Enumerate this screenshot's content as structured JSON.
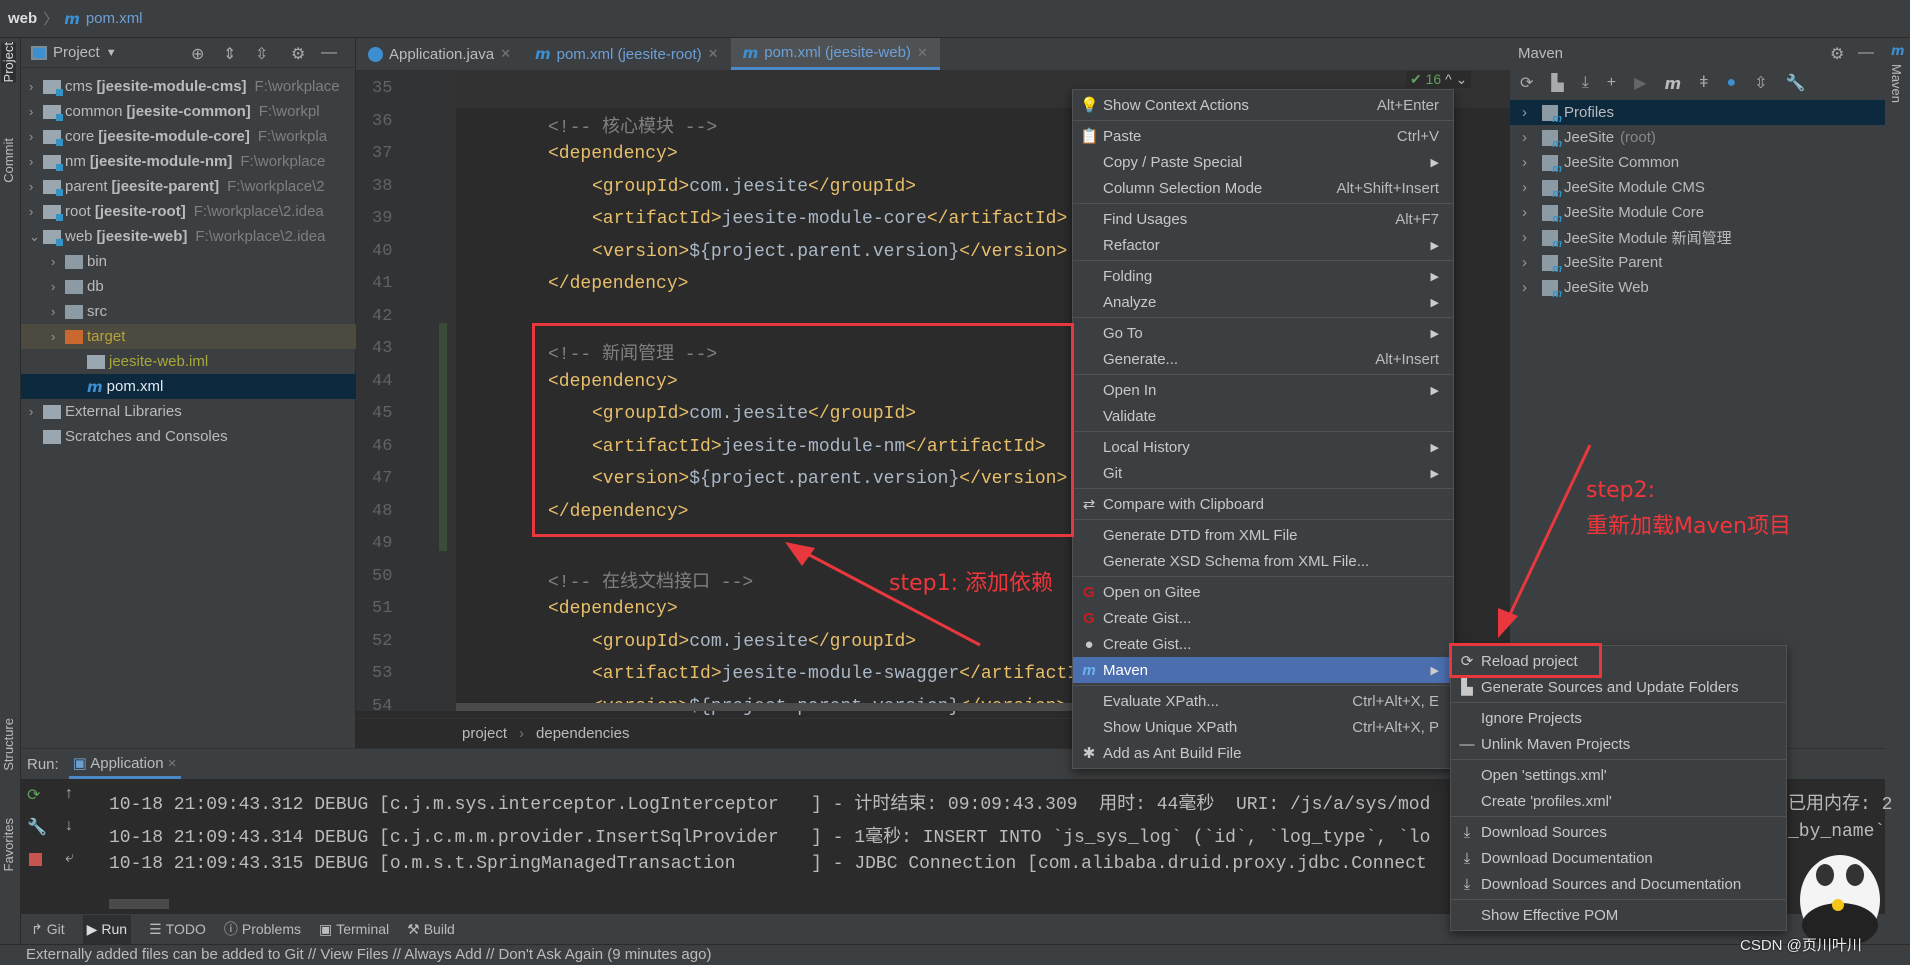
{
  "topbar": {
    "crumb": "web",
    "file": "pom.xml"
  },
  "left_strip": {
    "project": "Project",
    "commit": "Commit",
    "structure": "Structure",
    "favorites": "Favorites"
  },
  "right_strip": {
    "maven": "Maven"
  },
  "project": {
    "title": "Project",
    "tree": [
      {
        "level": 0,
        "chev": "›",
        "icon": "module",
        "name": "cms",
        "bold": "[jeesite-module-cms]",
        "path": "F:\\workplace"
      },
      {
        "level": 0,
        "chev": "›",
        "icon": "module",
        "name": "common",
        "bold": "[jeesite-common]",
        "path": "F:\\workpl"
      },
      {
        "level": 0,
        "chev": "›",
        "icon": "module",
        "name": "core",
        "bold": "[jeesite-module-core]",
        "path": "F:\\workpla"
      },
      {
        "level": 0,
        "chev": "›",
        "icon": "module",
        "name": "nm",
        "bold": "[jeesite-module-nm]",
        "path": "F:\\workplace"
      },
      {
        "level": 0,
        "chev": "›",
        "icon": "module",
        "name": "parent",
        "bold": "[jeesite-parent]",
        "path": "F:\\workplace\\2"
      },
      {
        "level": 0,
        "chev": "›",
        "icon": "module",
        "name": "root",
        "bold": "[jeesite-root]",
        "path": "F:\\workplace\\2.idea"
      },
      {
        "level": 0,
        "chev": "⌄",
        "icon": "module",
        "name": "web",
        "bold": "[jeesite-web]",
        "path": "F:\\workplace\\2.idea"
      },
      {
        "level": 1,
        "chev": "›",
        "icon": "folder",
        "name": "bin"
      },
      {
        "level": 1,
        "chev": "›",
        "icon": "folder",
        "name": "db"
      },
      {
        "level": 1,
        "chev": "›",
        "icon": "folder",
        "name": "src"
      },
      {
        "level": 1,
        "chev": "›",
        "icon": "folder-excluded",
        "name": "target",
        "state": "excluded"
      },
      {
        "level": 2,
        "chev": "",
        "icon": "iml-file",
        "name": "jeesite-web.iml",
        "state": "untracked"
      },
      {
        "level": 2,
        "chev": "",
        "icon": "maven-file",
        "name": "pom.xml",
        "state": "selected"
      },
      {
        "level": 0,
        "chev": "›",
        "icon": "libraries",
        "name": "External Libraries"
      },
      {
        "level": 0,
        "chev": "",
        "icon": "scratches",
        "name": "Scratches and Consoles"
      }
    ]
  },
  "editor": {
    "tabs": [
      {
        "label": "Application.java",
        "icon": "java-class-icon",
        "active": false
      },
      {
        "label": "pom.xml (jeesite-root)",
        "icon": "maven-icon",
        "active": false
      },
      {
        "label": "pom.xml (jeesite-web)",
        "icon": "maven-icon",
        "active": true
      }
    ],
    "inspections": "✔ 16",
    "lines": [
      {
        "n": "35",
        "indent": 0,
        "text": ""
      },
      {
        "n": "36",
        "indent": 1,
        "text": "<!-- 核心模块 -->"
      },
      {
        "n": "37",
        "indent": 1,
        "text": "<dependency>"
      },
      {
        "n": "38",
        "indent": 2,
        "text": "<groupId>com.jeesite</groupId>"
      },
      {
        "n": "39",
        "indent": 2,
        "text": "<artifactId>jeesite-module-core</artifactId>"
      },
      {
        "n": "40",
        "indent": 2,
        "text": "<version>${project.parent.version}</version>"
      },
      {
        "n": "41",
        "indent": 1,
        "text": "</dependency>"
      },
      {
        "n": "42",
        "indent": 0,
        "text": ""
      },
      {
        "n": "43",
        "indent": 1,
        "text": "<!-- 新闻管理 -->"
      },
      {
        "n": "44",
        "indent": 1,
        "text": "<dependency>"
      },
      {
        "n": "45",
        "indent": 2,
        "text": "<groupId>com.jeesite</groupId>"
      },
      {
        "n": "46",
        "indent": 2,
        "text": "<artifactId>jeesite-module-nm</artifactId>"
      },
      {
        "n": "47",
        "indent": 2,
        "text": "<version>${project.parent.version}</version>"
      },
      {
        "n": "48",
        "indent": 1,
        "text": "</dependency>"
      },
      {
        "n": "49",
        "indent": 0,
        "text": ""
      },
      {
        "n": "50",
        "indent": 1,
        "text": "<!-- 在线文档接口 -->"
      },
      {
        "n": "51",
        "indent": 1,
        "text": "<dependency>"
      },
      {
        "n": "52",
        "indent": 2,
        "text": "<groupId>com.jeesite</groupId>"
      },
      {
        "n": "53",
        "indent": 2,
        "text": "<artifactId>jeesite-module-swagger</artifactId>"
      },
      {
        "n": "54",
        "indent": 2,
        "text": "<version>${project.parent.version}</version>"
      }
    ],
    "breadcrumbs": [
      "project",
      "dependencies"
    ]
  },
  "annotations": {
    "step1": "step1: 添加依赖",
    "step2_line1": "step2:",
    "step2_line2": "重新加载Maven项目"
  },
  "context_menu": [
    [
      {
        "label": "Show Context Actions",
        "shortcut": "Alt+Enter",
        "icon": "bulb-icon"
      }
    ],
    [
      {
        "label": "Paste",
        "shortcut": "Ctrl+V",
        "icon": "clipboard-icon"
      },
      {
        "label": "Copy / Paste Special",
        "submenu": true
      },
      {
        "label": "Column Selection Mode",
        "shortcut": "Alt+Shift+Insert"
      }
    ],
    [
      {
        "label": "Find Usages",
        "shortcut": "Alt+F7"
      },
      {
        "label": "Refactor",
        "submenu": true
      }
    ],
    [
      {
        "label": "Folding",
        "submenu": true
      },
      {
        "label": "Analyze",
        "submenu": true
      }
    ],
    [
      {
        "label": "Go To",
        "submenu": true
      },
      {
        "label": "Generate...",
        "shortcut": "Alt+Insert"
      }
    ],
    [
      {
        "label": "Open In",
        "submenu": true
      },
      {
        "label": "Validate"
      }
    ],
    [
      {
        "label": "Local History",
        "submenu": true
      },
      {
        "label": "Git",
        "submenu": true
      }
    ],
    [
      {
        "label": "Compare with Clipboard",
        "icon": "compare-icon"
      }
    ],
    [
      {
        "label": "Generate DTD from XML File"
      },
      {
        "label": "Generate XSD Schema from XML File..."
      }
    ],
    [
      {
        "label": "Open on Gitee",
        "icon": "gitee-icon"
      },
      {
        "label": "Create Gist...",
        "icon": "gitee-icon"
      },
      {
        "label": "Create Gist...",
        "icon": "github-icon"
      },
      {
        "label": "Maven",
        "submenu": true,
        "icon": "maven-icon",
        "highlighted": true
      }
    ],
    [
      {
        "label": "Evaluate XPath...",
        "shortcut": "Ctrl+Alt+X, E"
      },
      {
        "label": "Show Unique XPath",
        "shortcut": "Ctrl+Alt+X, P"
      },
      {
        "label": "Add as Ant Build File",
        "icon": "ant-icon"
      }
    ]
  ],
  "maven_submenu": [
    [
      {
        "label": "Reload project",
        "icon": "reload-icon"
      },
      {
        "label": "Generate Sources and Update Folders",
        "icon": "generate-sources-icon"
      }
    ],
    [
      {
        "label": "Ignore Projects"
      },
      {
        "label": "Unlink Maven Projects",
        "icon": "minus-icon"
      }
    ],
    [
      {
        "label": "Open 'settings.xml'"
      },
      {
        "label": "Create 'profiles.xml'"
      }
    ],
    [
      {
        "label": "Download Sources",
        "icon": "download-icon"
      },
      {
        "label": "Download Documentation",
        "icon": "download-icon"
      },
      {
        "label": "Download Sources and Documentation",
        "icon": "download-icon"
      }
    ],
    [
      {
        "label": "Show Effective POM"
      }
    ]
  ],
  "maven": {
    "title": "Maven",
    "items": [
      {
        "label": "Profiles",
        "selected": true
      },
      {
        "label": "JeeSite",
        "suffix": "(root)"
      },
      {
        "label": "JeeSite Common"
      },
      {
        "label": "JeeSite Module CMS"
      },
      {
        "label": "JeeSite Module Core"
      },
      {
        "label": "JeeSite Module 新闻管理"
      },
      {
        "label": "JeeSite Parent"
      },
      {
        "label": "JeeSite Web"
      }
    ]
  },
  "run": {
    "label": "Run:",
    "config": "Application",
    "log": [
      {
        "text": "10-18 21:09:43.312 DEBUG [c.j.m.sys.interceptor.LogInterceptor   ] - 计时结束: 09:09:43.309  用时: 44毫秒  URI: /js/a/sys/mod",
        "tail": "已用内存: 2"
      },
      {
        "text": "10-18 21:09:43.314 DEBUG [c.j.c.m.m.provider.InsertSqlProvider   ] - 1毫秒: INSERT INTO `js_sys_log` (`id`, `log_type`, `lo",
        "tail": "_by_name`"
      },
      {
        "text": "10-18 21:09:43.315 DEBUG [o.m.s.t.SpringManagedTransaction       ] - JDBC Connection [com.alibaba.druid.proxy.jdbc.Connect",
        "tail": ""
      }
    ]
  },
  "bottom_tabs": [
    "Git",
    "Run",
    "TODO",
    "Problems",
    "Terminal",
    "Build"
  ],
  "status": "Externally added files can be added to Git // View Files // Always Add // Don't Ask Again (9 minutes ago)",
  "watermark": "CSDN @页川叶川",
  "colors": {
    "accent": "#4b6eaf",
    "annotation": "#e8383d",
    "tag": "#e8bf6a",
    "comment": "#808080"
  }
}
